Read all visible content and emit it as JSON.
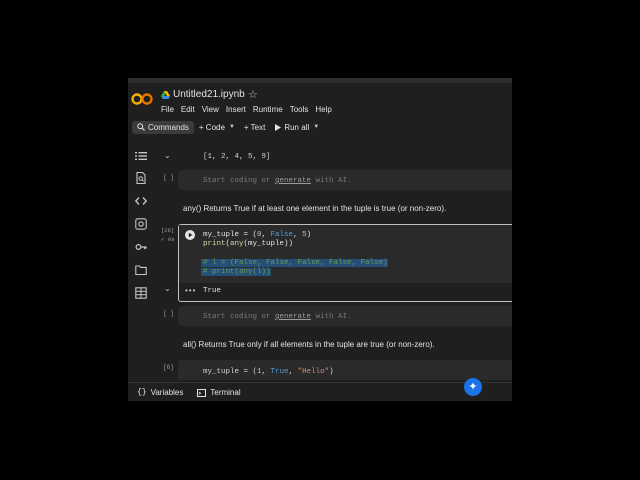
{
  "header": {
    "title": "Untitled21.ipynb",
    "menu": [
      "File",
      "Edit",
      "View",
      "Insert",
      "Runtime",
      "Tools",
      "Help"
    ]
  },
  "toolbar": {
    "commands": "Commands",
    "code": "+ Code",
    "text": "+ Text",
    "run_all": "Run all"
  },
  "cells": {
    "output_top": "[1, 2, 4, 5, 9]",
    "empty1": {
      "bracket": "[ ]",
      "placeholder_a": "Start coding or ",
      "placeholder_link": "generate",
      "placeholder_b": " with AI."
    },
    "md1": "any() Returns True if at least one element in the tuple is true (or non-zero).",
    "active": {
      "exec_count": "[26]",
      "exec_time": "0s",
      "line1": {
        "var": "my_tuple = (",
        "n0": "0",
        "sep1": ", ",
        "kf": "False",
        "sep2": ", ",
        "n5": "5",
        "end": ")"
      },
      "line2": {
        "fn1": "print",
        "p1": "(",
        "fn2": "any",
        "p2": "(my_tuple))"
      },
      "line3": "# l = (False, False, False, False, False)",
      "line4": "# print(any(l))",
      "output": "True"
    },
    "empty2": {
      "bracket": "[ ]",
      "placeholder_a": "Start coding or ",
      "placeholder_link": "generate",
      "placeholder_b": " with AI."
    },
    "md2": "all() Returns True only if all elements in the tuple are true (or non-zero).",
    "next": {
      "exec_count": "[6]",
      "code_a": "my_tuple = (",
      "code_b": "1",
      "code_c": ", ",
      "code_d": "True",
      "code_e": ", ",
      "code_f": "\"Hello\"",
      "code_g": ")"
    }
  },
  "statusbar": {
    "variables": "Variables",
    "terminal": "Terminal"
  },
  "colors": {
    "accent_blue": "#1a73e8",
    "logo_orange": "#f9ab00",
    "selection": "#264f78"
  }
}
